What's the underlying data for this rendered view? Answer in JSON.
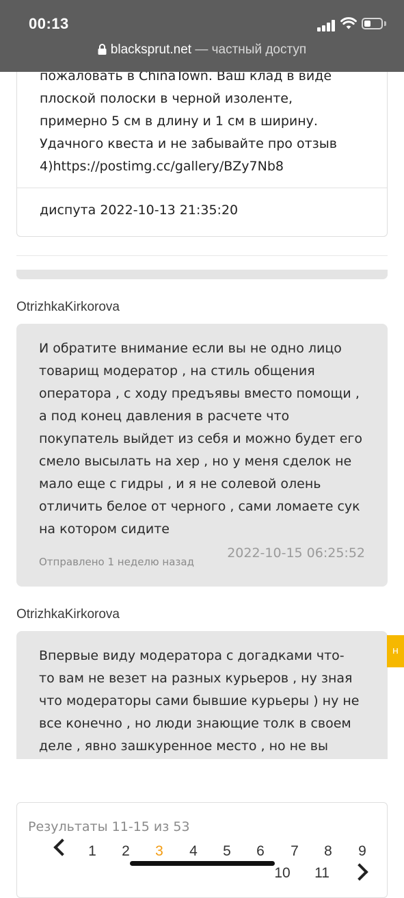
{
  "status_bar": {
    "time": "00:13"
  },
  "url_bar": {
    "domain": "blacksprut.net",
    "suffix": "— частный доступ"
  },
  "post1": {
    "lines": [
      "пожаловать в ChinaTown. Ваш клад в виде",
      "плоской полоски в черной изоленте,",
      "примерно 5 см в длину и 1 см в ширину.",
      "Удачного квеста и не забывайте про отзыв",
      "4)https://postimg.cc/gallery/BZy7Nb8"
    ],
    "footer": "диспута 2022-10-13 21:35:20"
  },
  "messages": [
    {
      "author": "OtrizhkaKirkorova",
      "lines": [
        "И обратите внимание если вы не одно лицо",
        "товарищ модератор , на стиль общения",
        "оператора , с ходу предъявы вместо помощи ,",
        "а под конец давления в расчете что",
        "покупатель выйдет из себя и можно будет его",
        "смело высылать на хер , но у меня сделок не",
        "мало еще с гидры , и я не солевой олень",
        "отличить белое от черного , сами ломаете сук",
        "на котором сидите"
      ],
      "sent": "Отправлено 1 неделю назад",
      "timestamp": "2022-10-15 06:25:52"
    },
    {
      "author": "OtrizhkaKirkorova",
      "lines": [
        "Впервые виду модератора с догадками что-",
        "то вам не везет на разных курьеров , ну зная",
        "что модераторы сами бывшие курьеры ) ну не",
        "все конечно , но люди знающие толк в своем",
        "деле , явно зашкуренное место , но не вы"
      ]
    }
  ],
  "side_tab": {
    "label": "н"
  },
  "pagination": {
    "results": "Результаты 11-15 из 53",
    "pages": [
      "1",
      "2",
      "3",
      "4",
      "5",
      "6",
      "7",
      "8",
      "9",
      "10",
      "11"
    ],
    "current": "3"
  },
  "colors": {
    "accent": "#f39c12",
    "bubble": "#e6e6e6",
    "topbar": "#5d5d5d",
    "side_tab": "#f6b800"
  }
}
